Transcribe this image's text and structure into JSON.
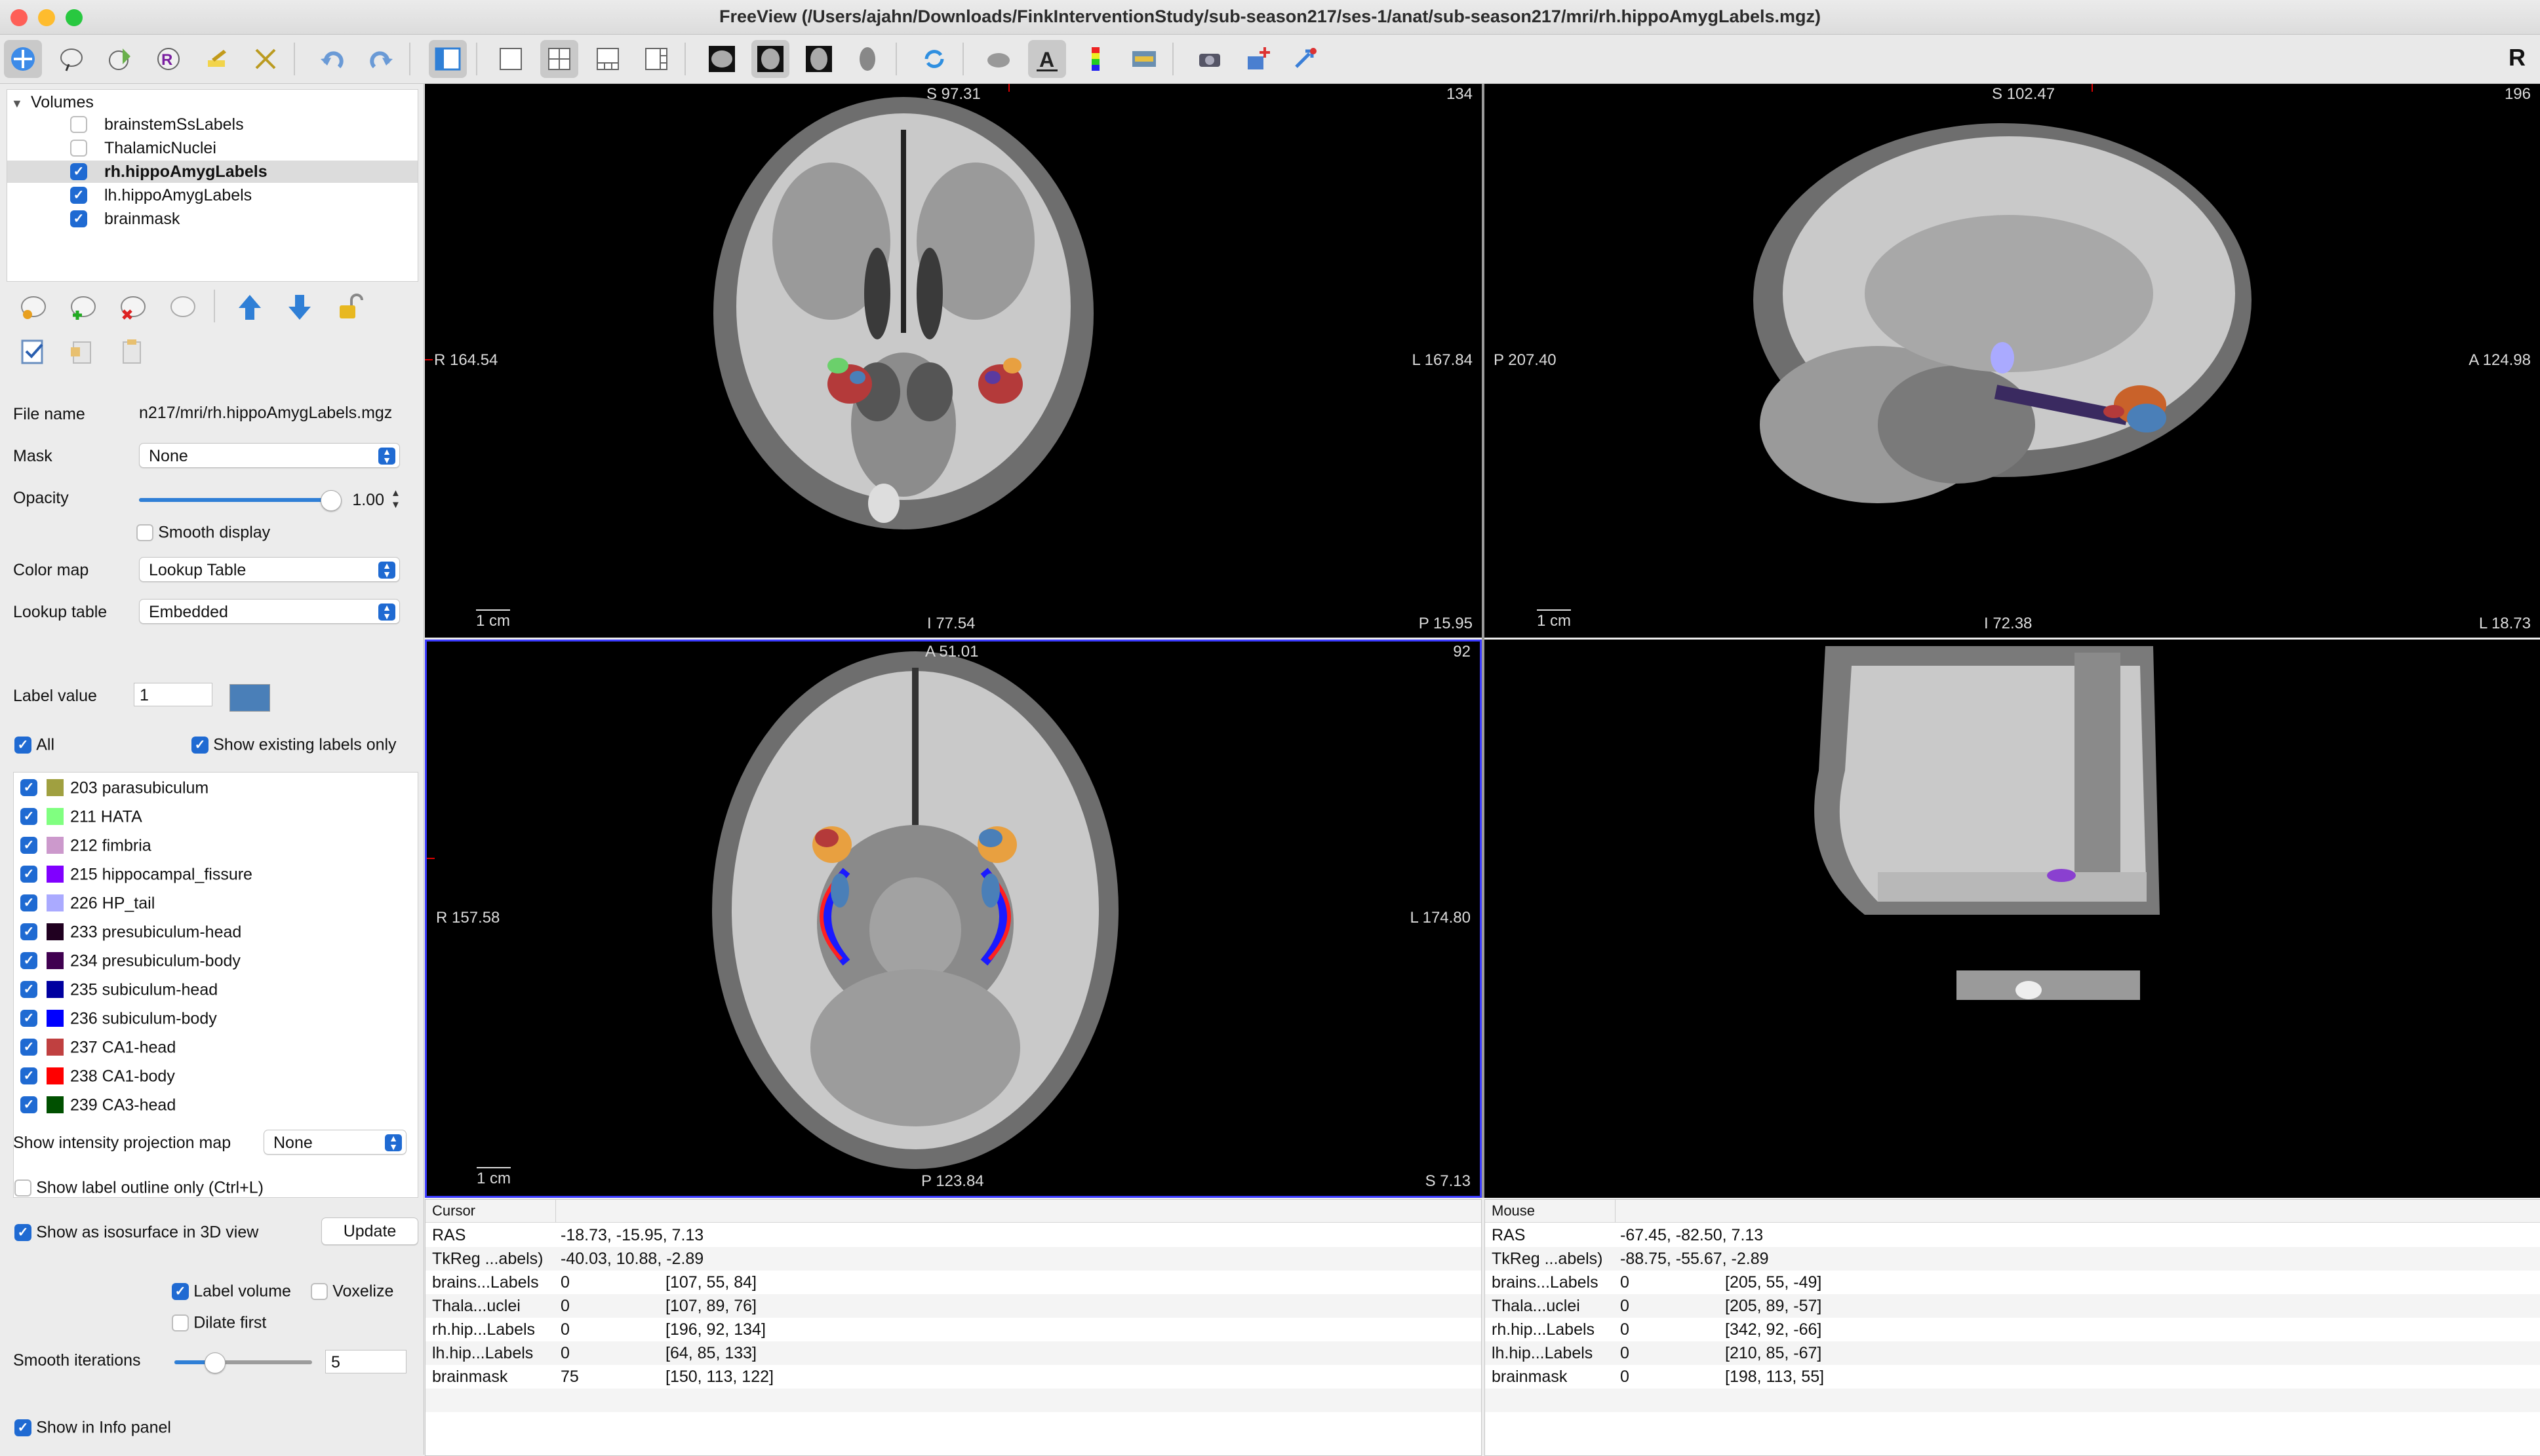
{
  "window": {
    "title": "FreeView (/Users/ajahn/Downloads/FinkInterventionStudy/sub-season217/ses-1/anat/sub-season217/mri/rh.hippoAmygLabels.mgz)",
    "corner_label": "R"
  },
  "layers": {
    "group": "Volumes",
    "items": [
      {
        "name": "brainstemSsLabels",
        "checked": false,
        "selected": false
      },
      {
        "name": "ThalamicNuclei",
        "checked": false,
        "selected": false
      },
      {
        "name": "rh.hippoAmygLabels",
        "checked": true,
        "selected": true
      },
      {
        "name": "lh.hippoAmygLabels",
        "checked": true,
        "selected": false
      },
      {
        "name": "brainmask",
        "checked": true,
        "selected": false
      }
    ]
  },
  "props": {
    "file_name_label": "File name",
    "file_name_value": "n217/mri/rh.hippoAmygLabels.mgz",
    "mask_label": "Mask",
    "mask_value": "None",
    "opacity_label": "Opacity",
    "opacity_value": "1.00",
    "opacity_level": 1.0,
    "smooth_display": "Smooth display",
    "colormap_label": "Color map",
    "colormap_value": "Lookup Table",
    "lookup_label": "Lookup table",
    "lookup_value": "Embedded",
    "label_value_label": "Label value",
    "label_value": "1",
    "label_value_color": "#4a7fb8",
    "all_label": "All",
    "show_existing": "Show existing labels only",
    "intensity_label": "Show intensity projection map",
    "intensity_value": "None",
    "outline_label": "Show label outline only (Ctrl+L)",
    "isosurface_label": "Show as isosurface in 3D view",
    "update_button": "Update",
    "label_volume": "Label volume",
    "voxelize": "Voxelize",
    "dilate_first": "Dilate first",
    "smooth_iter_label": "Smooth iterations",
    "smooth_iter_value": "5",
    "show_info_panel": "Show in Info panel"
  },
  "labels": [
    {
      "text": "203 parasubiculum",
      "color": "#a0a040"
    },
    {
      "text": "211 HATA",
      "color": "#80ff80"
    },
    {
      "text": "212 fimbria",
      "color": "#cc99cc"
    },
    {
      "text": "215 hippocampal_fissure",
      "color": "#8000ff"
    },
    {
      "text": "226 HP_tail",
      "color": "#aaaaff"
    },
    {
      "text": "233 presubiculum-head",
      "color": "#200020"
    },
    {
      "text": "234 presubiculum-body",
      "color": "#400050"
    },
    {
      "text": "235 subiculum-head",
      "color": "#0000a0"
    },
    {
      "text": "236 subiculum-body",
      "color": "#0000ff"
    },
    {
      "text": "237 CA1-head",
      "color": "#c04040"
    },
    {
      "text": "238 CA1-body",
      "color": "#ff0000"
    },
    {
      "text": "239 CA3-head",
      "color": "#005000"
    }
  ],
  "views": {
    "coronal": {
      "top": "S 97.31",
      "left": "R 164.54",
      "right": "L 167.84",
      "bottom": "I 77.54",
      "corner_tr": "134",
      "corner_br": "P 15.95",
      "scale": "1 cm"
    },
    "sagittal": {
      "top": "S 102.47",
      "left": "P 207.40",
      "right": "A 124.98",
      "bottom": "I 72.38",
      "corner_tr": "196",
      "corner_br": "L 18.73",
      "scale": "1 cm"
    },
    "axial": {
      "top": "A 51.01",
      "left": "R 157.58",
      "right": "L 174.80",
      "bottom": "P 123.84",
      "corner_tr": "92",
      "corner_br": "S 7.13",
      "scale": "1 cm"
    }
  },
  "cursor_panel": {
    "header": "Cursor",
    "rows": [
      {
        "name": "RAS",
        "value": "-18.73, -15.95, 7.13",
        "coord": ""
      },
      {
        "name": "TkReg ...abels)",
        "value": "-40.03, 10.88, -2.89",
        "coord": ""
      },
      {
        "name": "brains...Labels",
        "value": "0",
        "coord": "[107, 55, 84]"
      },
      {
        "name": "Thala...uclei",
        "value": "0",
        "coord": "[107, 89, 76]"
      },
      {
        "name": "rh.hip...Labels",
        "value": "0",
        "coord": "[196, 92, 134]"
      },
      {
        "name": "lh.hip...Labels",
        "value": "0",
        "coord": "[64, 85, 133]"
      },
      {
        "name": "brainmask",
        "value": "75",
        "coord": "[150, 113, 122]"
      }
    ]
  },
  "mouse_panel": {
    "header": "Mouse",
    "rows": [
      {
        "name": "RAS",
        "value": "-67.45, -82.50, 7.13",
        "coord": ""
      },
      {
        "name": "TkReg ...abels)",
        "value": "-88.75, -55.67, -2.89",
        "coord": ""
      },
      {
        "name": "brains...Labels",
        "value": "0",
        "coord": "[205, 55, -49]"
      },
      {
        "name": "Thala...uclei",
        "value": "0",
        "coord": "[205, 89, -57]"
      },
      {
        "name": "rh.hip...Labels",
        "value": "0",
        "coord": "[342, 92, -66]"
      },
      {
        "name": "lh.hip...Labels",
        "value": "0",
        "coord": "[210, 85, -67]"
      },
      {
        "name": "brainmask",
        "value": "0",
        "coord": "[198, 113, 55]"
      }
    ]
  }
}
